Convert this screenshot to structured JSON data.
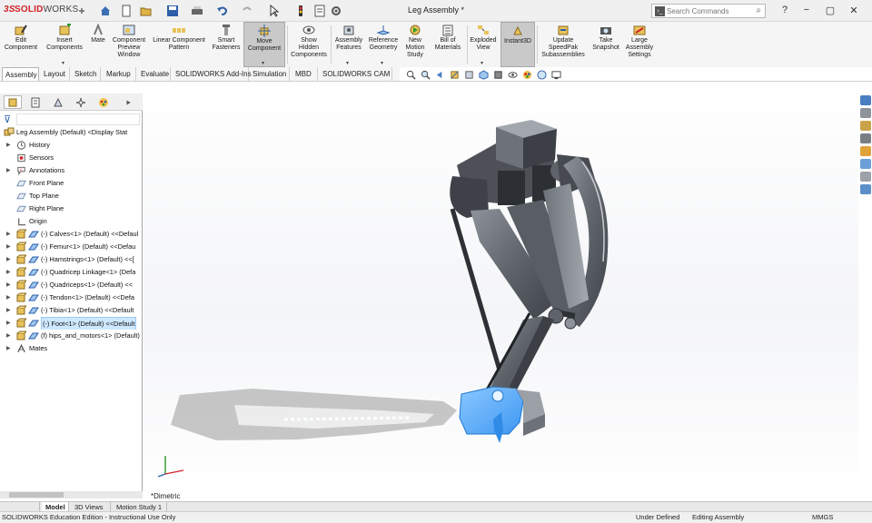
{
  "app": {
    "logo_mark": "3S",
    "logo_solid": "SOLID",
    "logo_works": "WORKS",
    "document_title": "Leg Assembly *"
  },
  "quick_access": {
    "icons": [
      "home-icon",
      "new-document-icon",
      "open-icon",
      "save-icon",
      "print-icon",
      "undo-icon",
      "select-icon",
      "rebuild-icon",
      "file-properties-icon",
      "options-icon"
    ]
  },
  "search": {
    "placeholder": "Search Commands"
  },
  "window_buttons": {
    "help": "?",
    "minimize": "−",
    "maximize": "▢",
    "close": "✕"
  },
  "ribbon": {
    "buttons": [
      {
        "label": "Edit\nComponent"
      },
      {
        "label": "Insert\nComponents"
      },
      {
        "label": "Mate"
      },
      {
        "label": "Component\nPreview\nWindow"
      },
      {
        "label": "Linear Component\nPattern"
      },
      {
        "label": "Smart\nFasteners"
      },
      {
        "label": "Move\nComponent"
      },
      {
        "label": "Show\nHidden\nComponents"
      },
      {
        "label": "Assembly\nFeatures"
      },
      {
        "label": "Reference\nGeometry"
      },
      {
        "label": "New\nMotion\nStudy"
      },
      {
        "label": "Bill of\nMaterials"
      },
      {
        "label": "Exploded\nView"
      },
      {
        "label": "Instant3D"
      },
      {
        "label": "Update\nSpeedPak\nSubassemblies"
      },
      {
        "label": "Take\nSnapshot"
      },
      {
        "label": "Large\nAssembly\nSettings"
      }
    ],
    "active_button": "Move Component"
  },
  "command_tabs": [
    "Assembly",
    "Layout",
    "Sketch",
    "Markup",
    "Evaluate",
    "SOLIDWORKS Add-Ins",
    "Simulation",
    "MBD",
    "SOLIDWORKS CAM"
  ],
  "active_command_tab": "Assembly",
  "tree": {
    "root": "Leg Assembly (Default) <Display Stat",
    "items": [
      {
        "label": "History",
        "type": "history"
      },
      {
        "label": "Sensors",
        "type": "sensors"
      },
      {
        "label": "Annotations",
        "type": "annotations"
      },
      {
        "label": "Front Plane",
        "type": "plane"
      },
      {
        "label": "Top Plane",
        "type": "plane"
      },
      {
        "label": "Right Plane",
        "type": "plane"
      },
      {
        "label": "Origin",
        "type": "origin"
      },
      {
        "label": "(-) Calves<1> (Default) <<Defaul",
        "type": "part"
      },
      {
        "label": "(-) Femur<1> (Default) <<Defau",
        "type": "part"
      },
      {
        "label": "(-) Hamstrings<1> (Default) <<[",
        "type": "part"
      },
      {
        "label": "(-) Quadricep Linkage<1> (Defa",
        "type": "part"
      },
      {
        "label": "(-) Quadriceps<1> (Default) <<",
        "type": "part"
      },
      {
        "label": "(-) Tendon<1> (Default) <<Defa",
        "type": "part"
      },
      {
        "label": "(-) Tibia<1> (Default) <<Default",
        "type": "part"
      },
      {
        "label": "(-) Foot<1> (Default) <<Default",
        "type": "part",
        "selected": true
      },
      {
        "label": "(f) hips_and_motors<1> (Default)",
        "type": "part"
      },
      {
        "label": "Mates",
        "type": "mates"
      }
    ]
  },
  "viewport": {
    "view_orientation": "*Dimetric",
    "selection_color": "#4aa3ff"
  },
  "bottom_tabs": [
    "Model",
    "3D Views",
    "Motion Study 1"
  ],
  "active_bottom_tab": "Model",
  "status": {
    "edition": "SOLIDWORKS Education Edition - Instructional Use Only",
    "definition": "Under Defined",
    "mode": "Editing Assembly",
    "units": "MMGS"
  },
  "colors": {
    "accent": "#d2232a",
    "selection": "#4aa3ff",
    "tree_selection": "#cde8ff"
  }
}
